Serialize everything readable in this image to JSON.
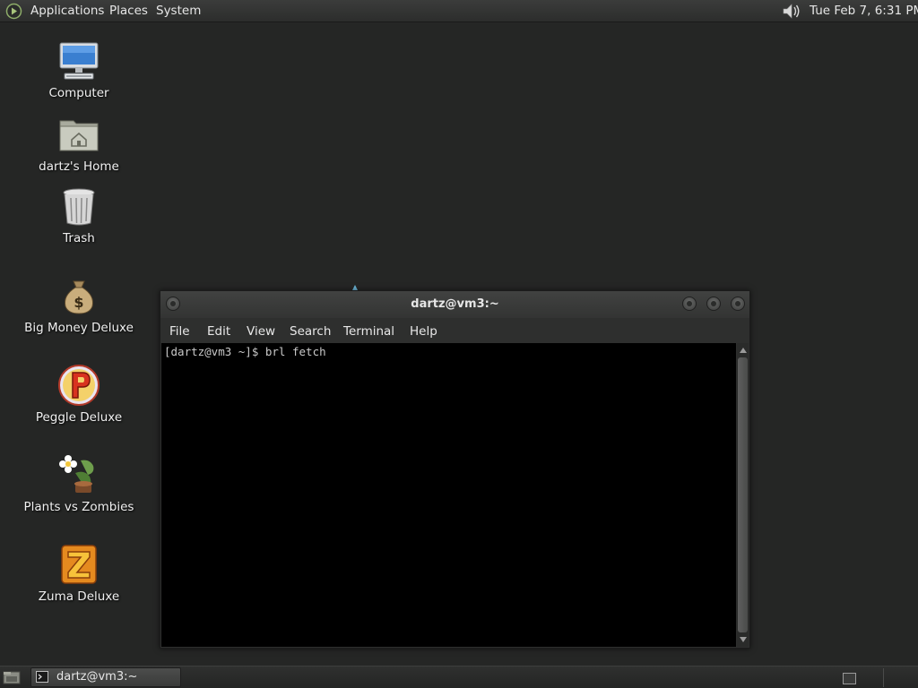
{
  "top_panel": {
    "menus": {
      "applications": "Applications",
      "places": "Places",
      "system": "System"
    },
    "clock": "Tue Feb  7,  6:31 PM"
  },
  "desktop": {
    "icons": [
      {
        "label": "Computer",
        "icon": "computer-icon"
      },
      {
        "label": "dartz's Home",
        "icon": "home-folder-icon"
      },
      {
        "label": "Trash",
        "icon": "trash-icon"
      },
      {
        "label": "Big Money Deluxe",
        "icon": "money-bag-icon"
      },
      {
        "label": "Peggle Deluxe",
        "icon": "peggle-icon"
      },
      {
        "label": "Plants vs Zombies",
        "icon": "plants-vs-zombies-icon"
      },
      {
        "label": "Zuma Deluxe",
        "icon": "zuma-icon"
      }
    ]
  },
  "terminal": {
    "title": "dartz@vm3:~",
    "menus": {
      "file": "File",
      "edit": "Edit",
      "view": "View",
      "search": "Search",
      "terminal": "Terminal",
      "help": "Help"
    },
    "lines": [
      "[dartz@vm3 ~]$ brl fetch"
    ]
  },
  "bottom_panel": {
    "task_label": "dartz@vm3:~"
  },
  "colors": {
    "desktop_bg": "#252625",
    "panel_bg": "#2f302f",
    "terminal_bg": "#000000",
    "terminal_fg": "#c9c9c9"
  }
}
